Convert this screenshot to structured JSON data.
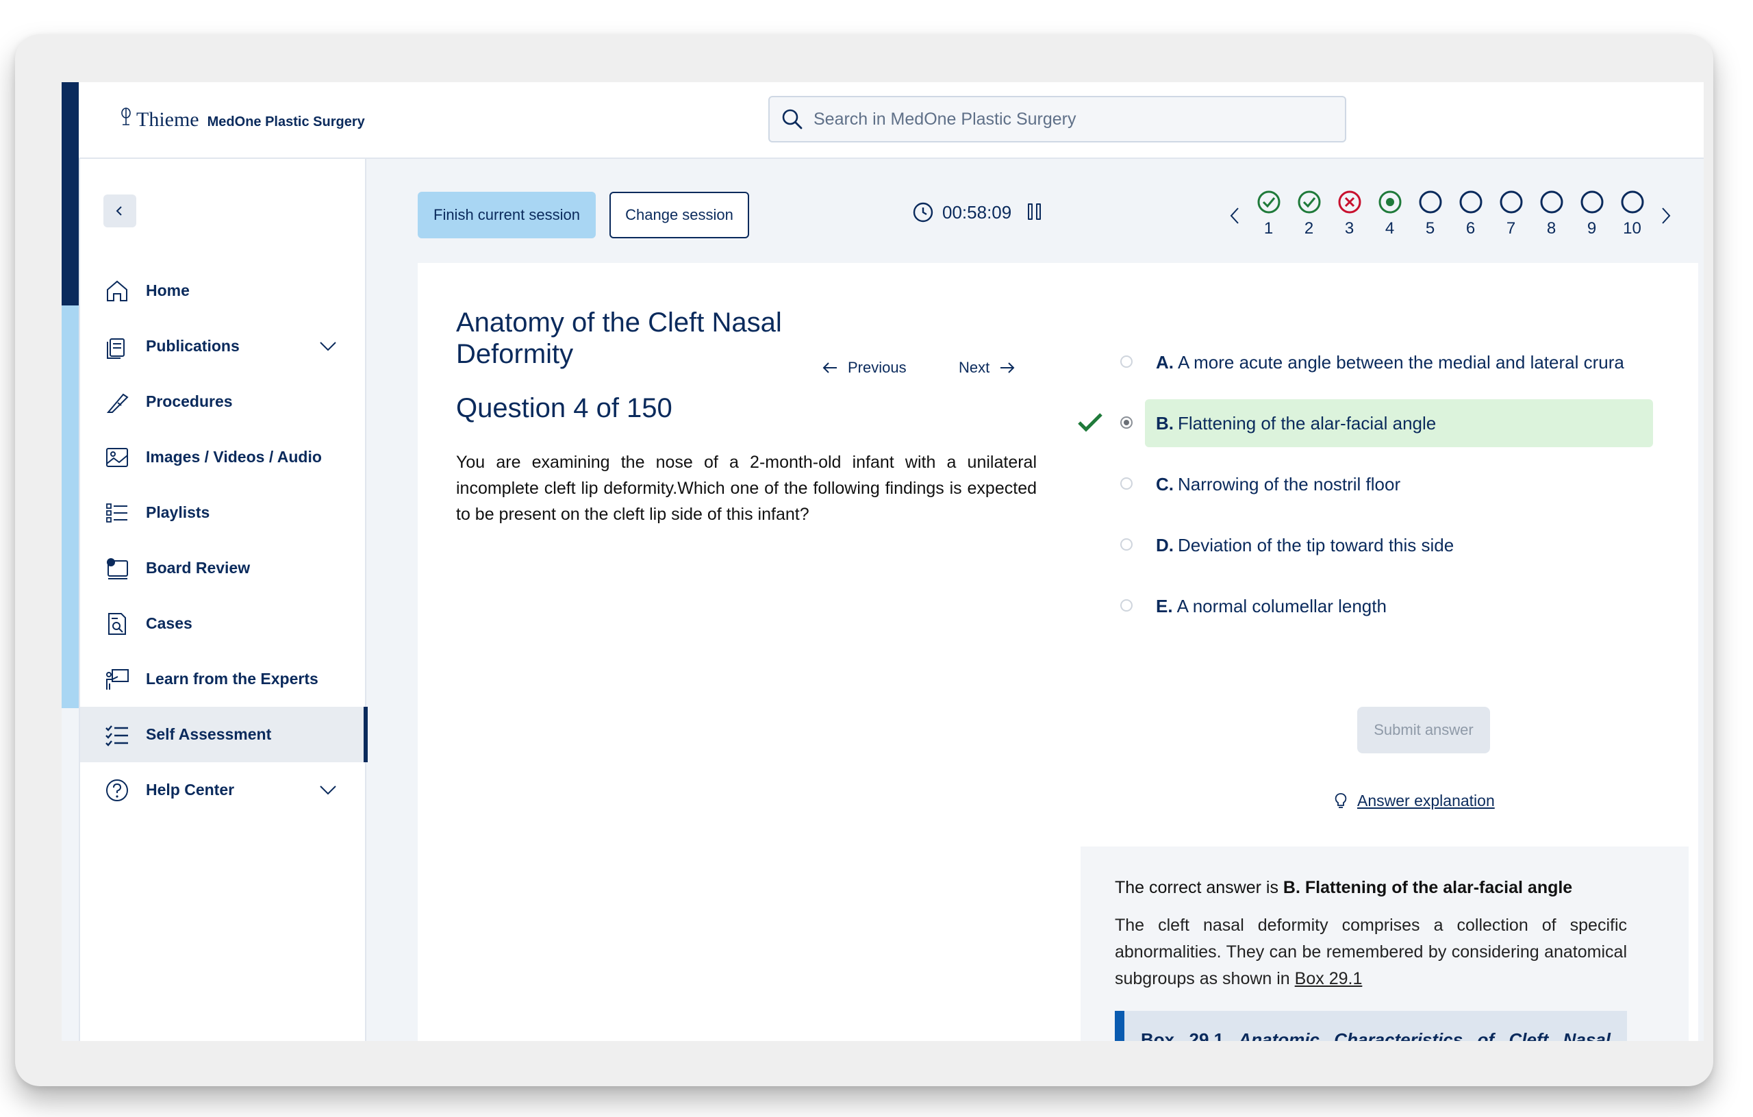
{
  "header": {
    "brand": "Thieme",
    "product": "MedOne Plastic Surgery",
    "search_placeholder": "Search in MedOne Plastic Surgery"
  },
  "sidebar": {
    "items": [
      {
        "label": "Home",
        "icon": "home-icon"
      },
      {
        "label": "Publications",
        "icon": "publications-icon",
        "expandable": true
      },
      {
        "label": "Procedures",
        "icon": "scalpel-icon"
      },
      {
        "label": "Images / Videos / Audio",
        "icon": "image-icon"
      },
      {
        "label": "Playlists",
        "icon": "list-icon"
      },
      {
        "label": "Board Review",
        "icon": "board-review-icon"
      },
      {
        "label": "Cases",
        "icon": "cases-icon"
      },
      {
        "label": "Learn from the Experts",
        "icon": "presentation-icon"
      },
      {
        "label": "Self Assessment",
        "icon": "checklist-icon",
        "active": true
      },
      {
        "label": "Help Center",
        "icon": "help-icon",
        "expandable": true
      }
    ]
  },
  "session": {
    "finish_label": "Finish current session",
    "change_label": "Change session",
    "timer": "00:58:09"
  },
  "question_nav": {
    "steps": [
      {
        "num": "1",
        "status": "correct"
      },
      {
        "num": "2",
        "status": "correct"
      },
      {
        "num": "3",
        "status": "incorrect"
      },
      {
        "num": "4",
        "status": "current"
      },
      {
        "num": "5",
        "status": "unanswered"
      },
      {
        "num": "6",
        "status": "unanswered"
      },
      {
        "num": "7",
        "status": "unanswered"
      },
      {
        "num": "8",
        "status": "unanswered"
      },
      {
        "num": "9",
        "status": "unanswered"
      },
      {
        "num": "10",
        "status": "unanswered"
      }
    ]
  },
  "question": {
    "title": "Anatomy of the Cleft Nasal Deformity",
    "prev_label": "Previous",
    "next_label": "Next",
    "counter": "Question 4 of 150",
    "text": "You are examining the nose of a 2-month-old infant with a unilateral incomplete cleft lip deformity.Which one of the following findings is expected to be present on the cleft lip side of this infant?"
  },
  "options": [
    {
      "letter": "A.",
      "text": "A more acute angle between the medial and lateral crura",
      "selected": false,
      "correct": false
    },
    {
      "letter": "B.",
      "text": "Flattening of the alar-facial angle",
      "selected": true,
      "correct": true
    },
    {
      "letter": "C.",
      "text": "Narrowing of the nostril floor",
      "selected": false,
      "correct": false
    },
    {
      "letter": "D.",
      "text": "Deviation of the tip toward this side",
      "selected": false,
      "correct": false
    },
    {
      "letter": "E.",
      "text": "A normal columellar length",
      "selected": false,
      "correct": false
    }
  ],
  "actions": {
    "submit_label": "Submit answer",
    "explanation_label": "Answer explanation"
  },
  "explanation": {
    "prefix": "The correct answer is",
    "answer": "B. Flattening of the alar-facial angle",
    "body": "The cleft nasal deformity comprises a collection of specific abnormalities. They can be remembered by considering anatomical subgroups as shown in",
    "box_link": "Box 29.1",
    "box_label": "Box 29.1",
    "box_title": "Anatomic Characteristics of Cleft Nasal Deformity"
  },
  "colors": {
    "navy": "#0a2a5c",
    "accent_light_blue": "#a9d6f3",
    "correct_green": "#1f7a3a",
    "incorrect_red": "#c8102e",
    "correct_bg": "#dcf3dc"
  }
}
